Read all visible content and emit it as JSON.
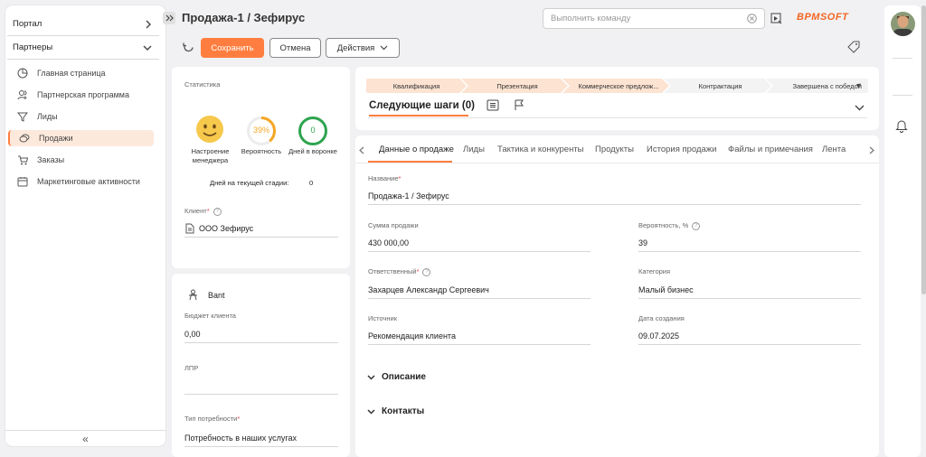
{
  "sidebar": {
    "sections": [
      {
        "label": "Портал",
        "chevron": "chevron-right-icon"
      },
      {
        "label": "Партнеры",
        "chevron": "chevron-down-icon"
      }
    ],
    "items": [
      {
        "label": "Главная страница",
        "icon": "pie-chart-icon"
      },
      {
        "label": "Партнерская программа",
        "icon": "people-icon"
      },
      {
        "label": "Лиды",
        "icon": "funnel-icon"
      },
      {
        "label": "Продажи",
        "icon": "coins-icon",
        "active": true
      },
      {
        "label": "Заказы",
        "icon": "cart-icon"
      },
      {
        "label": "Маркетинговые активности",
        "icon": "calendar-icon"
      }
    ],
    "collapse_glyph": "«"
  },
  "header": {
    "title": "Продажа-1 / Зефирус",
    "command_placeholder": "Выполнить команду",
    "logo": "BPMSOFT"
  },
  "toolbar": {
    "save_label": "Сохранить",
    "cancel_label": "Отмена",
    "actions_label": "Действия"
  },
  "stats": {
    "title": "Статистика",
    "mood_label": "Настроение менеджера",
    "probability_value": "39%",
    "probability_label": "Вероятность",
    "days_value": "0",
    "days_label": "Дней в воронке",
    "days_stage_label": "Дней на текущей стадии:",
    "days_stage_value": "0",
    "client_label": "Клиент",
    "client_value": "ООО Зефирус"
  },
  "bant": {
    "title": "Bant",
    "budget_label": "Бюджет клиента",
    "budget_value": "0,00",
    "lpr_label": "ЛПР",
    "need_label": "Тип потребности",
    "need_value": "Потребность в наших услугах"
  },
  "stages": [
    "Квалификация",
    "Презентация",
    "Коммерческое предлож...",
    "Контрактация",
    "Завершена с победой"
  ],
  "next_steps": "Следующие шаги (0)",
  "tabs": [
    "Данные о продаже",
    "Лиды",
    "Тактика и конкуренты",
    "Продукты",
    "История продажи",
    "Файлы и примечания",
    "Лента"
  ],
  "form": {
    "name_label": "Название",
    "name_value": "Продажа-1 / Зефирус",
    "amount_label": "Сумма продажи",
    "amount_value": "430 000,00",
    "prob_label": "Вероятность, %",
    "prob_value": "39",
    "owner_label": "Ответственный",
    "owner_value": "Захарцев Александр Сергеевич",
    "category_label": "Категория",
    "category_value": "Малый бизнес",
    "source_label": "Источник",
    "source_value": "Рекомендация клиента",
    "created_label": "Дата создания",
    "created_value": "09.07.2025",
    "description_label": "Описание",
    "contacts_label": "Контакты"
  },
  "colors": {
    "accent": "#ff7e3f",
    "stage_done": "#fde3d2",
    "green": "#2ea44f"
  }
}
